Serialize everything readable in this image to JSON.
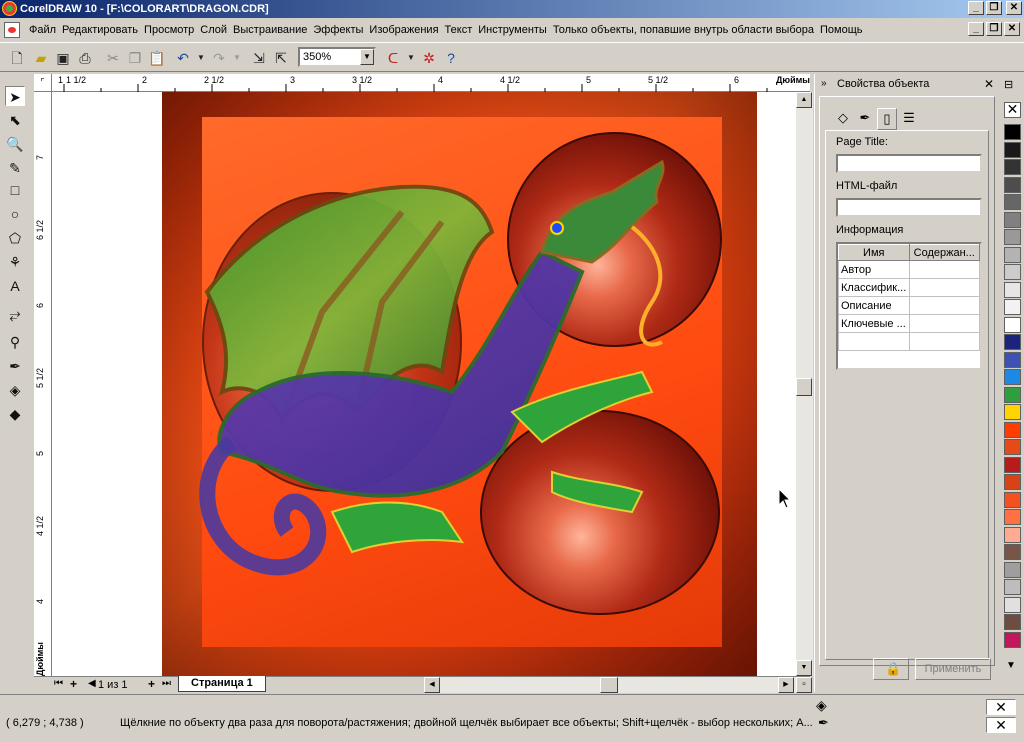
{
  "window": {
    "title": "CorelDRAW 10 - [F:\\COLORART\\DRAGON.CDR]",
    "controls": {
      "minimize": "_",
      "maximize": "❐",
      "close": "✕"
    }
  },
  "menu": {
    "items": [
      "Файл",
      "Редактировать",
      "Просмотр",
      "Слой",
      "Выстраивание",
      "Эффекты",
      "Изображения",
      "Текст",
      "Инструменты",
      "Только объекты, попавшие внутрь области выбора",
      "Помощь"
    ]
  },
  "toolbar": {
    "zoom_value": "350%"
  },
  "rulers": {
    "top_labels": [
      "1",
      "1 1/2",
      "2",
      "2 1/2",
      "3",
      "3 1/2",
      "4",
      "4 1/2",
      "5",
      "5 1/2",
      "6",
      "Дюймы"
    ],
    "left_labels": [
      "7",
      "6 1/2",
      "6",
      "5 1/2",
      "5",
      "4 1/2",
      "4",
      "Дюймы"
    ]
  },
  "pagebar": {
    "page_counter": "1 из 1",
    "page_tab": "Страница 1"
  },
  "docker": {
    "title": "Свойства объекта",
    "page_title_label": "Page Title:",
    "html_file_label": "HTML-файл",
    "info_label": "Информация",
    "table_headers": [
      "Имя",
      "Содержан..."
    ],
    "table_rows": [
      "Автор",
      "Классифик...",
      "Описание",
      "Ключевые ...",
      ""
    ],
    "apply_button": "Применить"
  },
  "palette": {
    "colors": [
      "#ffffff",
      "#000000",
      "#1a1a1a",
      "#333333",
      "#4d4d4d",
      "#666666",
      "#808080",
      "#999999",
      "#b3b3b3",
      "#cccccc",
      "#e6e6e6",
      "#f2f2f2",
      "#ffffff",
      "#1a237e",
      "#3f51b5",
      "#1e88e5",
      "#2e9e3e",
      "#ffd400",
      "#ff3d00",
      "#e64a19",
      "#b71c1c",
      "#d84315",
      "#f4511e",
      "#ff7043",
      "#ffab91",
      "#795548",
      "#9e9e9e",
      "#bdbdbd",
      "#e0e0e0",
      "#6d4c41",
      "#c2185b"
    ]
  },
  "status": {
    "coords": "( 6,279 ; 4,738 )",
    "hint": "Щёлкние по объекту два раза для поворота/растяжения; двойной щелчёк выбирает все объекты; Shift+щелчёк - выбор нескольких; A..."
  }
}
